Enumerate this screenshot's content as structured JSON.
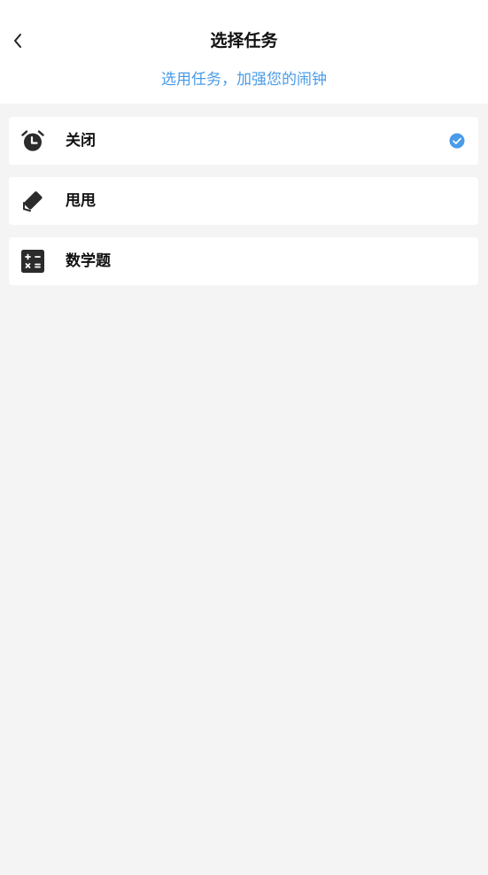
{
  "header": {
    "title": "选择任务",
    "subtitle": "选用任务，加强您的闹钟",
    "back_icon": "chevron-left-icon"
  },
  "tasks": {
    "items": [
      {
        "label": "关闭",
        "icon": "alarm-clock-icon",
        "selected": true
      },
      {
        "label": "甩甩",
        "icon": "shake-phone-icon",
        "selected": false
      },
      {
        "label": "数学题",
        "icon": "calculator-icon",
        "selected": false
      }
    ]
  },
  "colors": {
    "accent": "#4a9be8",
    "background": "#f4f4f4",
    "card": "#ffffff",
    "text": "#111111"
  }
}
